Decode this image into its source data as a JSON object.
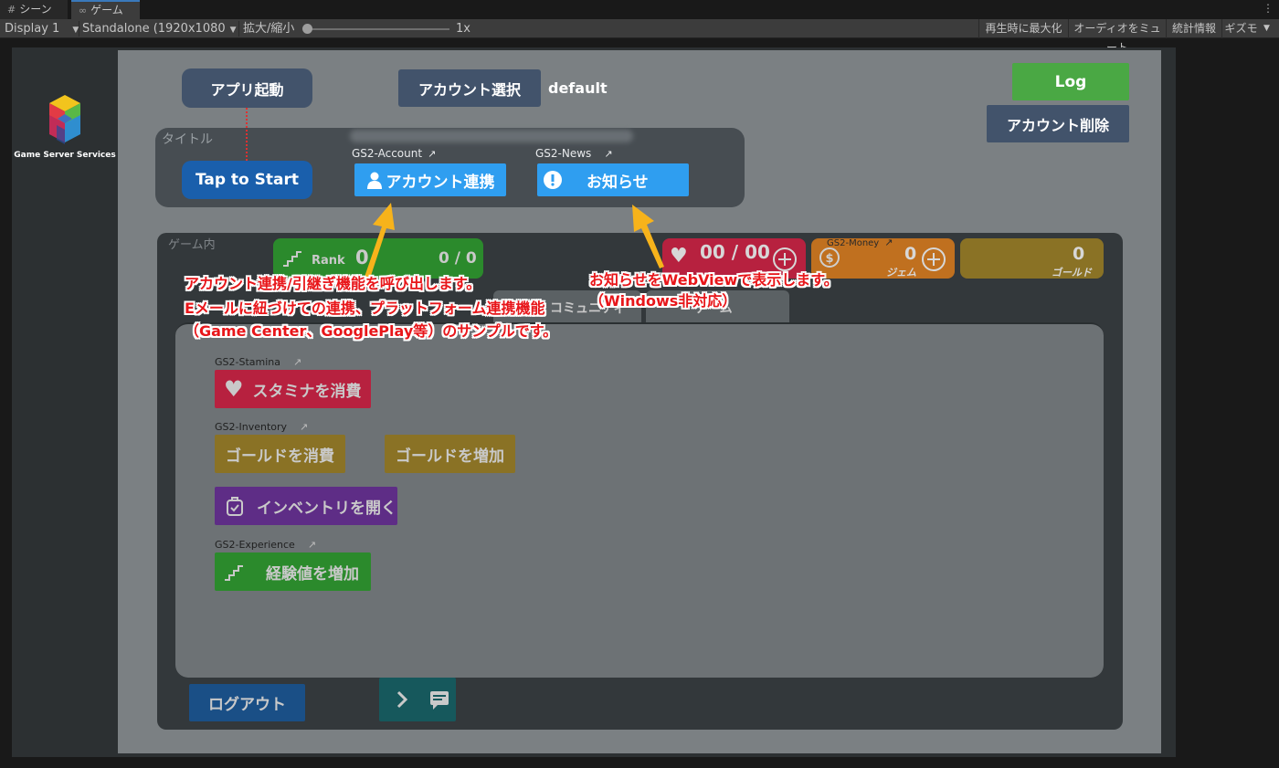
{
  "editor": {
    "tabs": [
      {
        "label": "シーン",
        "icon": "grid-icon"
      },
      {
        "label": "ゲーム",
        "icon": "gamepad-icon"
      }
    ],
    "toolbar": {
      "display": "Display 1",
      "resolution": "Standalone (1920x1080",
      "scale_label": "拡大/縮小",
      "scale_value": "1x",
      "maximize": "再生時に最大化",
      "mute": "オーディオをミュート",
      "stats": "統計情報",
      "gizmos": "ギズモ"
    }
  },
  "logo": {
    "text": "Game Server Services"
  },
  "top": {
    "app_start": "アプリ起動",
    "account_select": "アカウント選択",
    "account_name": "default",
    "log": "Log",
    "account_delete": "アカウント削除"
  },
  "title_panel": {
    "label": "タイトル",
    "tap_to_start": "Tap to Start",
    "account_gs2_label": "GS2-Account",
    "account_link": "アカウント連携",
    "news_gs2_label": "GS2-News",
    "news": "お知らせ"
  },
  "game_panel": {
    "label": "ゲーム内",
    "rank_label": "Rank",
    "rank_value": "0",
    "exp_value": "0 / 0",
    "stamina_value": "00 / 00",
    "money_gs2_label": "GS2-Money",
    "gem_value": "0",
    "gem_label": "ジェム",
    "gold_value": "0",
    "gold_label": "ゴールド",
    "behind_tab_1": "コミュニティ",
    "behind_tab_2": "ゲーム"
  },
  "actions": {
    "stamina_gs2_label": "GS2-Stamina",
    "consume_stamina": "スタミナを消費",
    "inventory_gs2_label": "GS2-Inventory",
    "consume_gold": "ゴールドを消費",
    "add_gold": "ゴールドを増加",
    "open_inventory": "インベントリを開く",
    "experience_gs2_label": "GS2-Experience",
    "add_experience": "経験値を増加"
  },
  "bottom": {
    "logout": "ログアウト"
  },
  "annotations": {
    "account_line1": "アカウント連携/引継ぎ機能を呼び出します。",
    "account_line2": "Eメールに紐づけての連携、プラットフォーム連携機能",
    "account_line3": "（Game Center、GooglePlay等）のサンプルです。",
    "news_line1": "お知らせをWebViewで表示します。",
    "news_line2": "（Windows非対応）"
  },
  "colors": {
    "slate": "#42536b",
    "blue_dark": "#1a5fac",
    "blue_light": "#2f9ef0",
    "log_green": "#4aa844",
    "annotation_red": "#e8161a",
    "arrow_yellow": "#f7b31b"
  }
}
